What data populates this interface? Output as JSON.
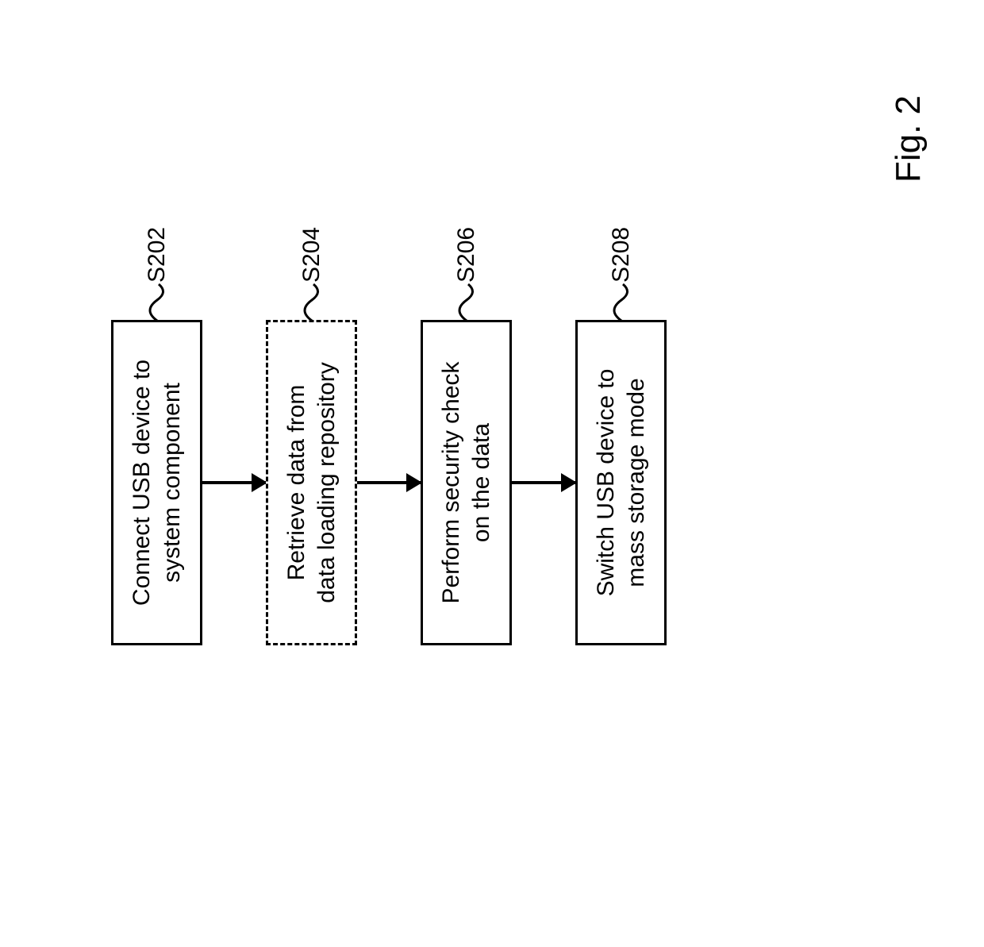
{
  "chart_data": {
    "type": "flowchart",
    "title": "Fig. 2",
    "steps": [
      {
        "id": "S202",
        "text": "Connect USB device to\nsystem component",
        "style": "solid"
      },
      {
        "id": "S204",
        "text": "Retrieve data from\ndata loading repository",
        "style": "dashed"
      },
      {
        "id": "S206",
        "text": "Perform security check\non the data",
        "style": "solid"
      },
      {
        "id": "S208",
        "text": "Switch USB device to\nmass storage mode",
        "style": "solid"
      }
    ]
  },
  "boxes": {
    "s202": {
      "line1": "Connect USB device to",
      "line2": "system component",
      "label": "S202"
    },
    "s204": {
      "line1": "Retrieve data from",
      "line2": "data loading repository",
      "label": "S204"
    },
    "s206": {
      "line1": "Perform security check",
      "line2": "on the data",
      "label": "S206"
    },
    "s208": {
      "line1": "Switch USB device to",
      "line2": "mass storage mode",
      "label": "S208"
    }
  },
  "figure_label": "Fig. 2"
}
